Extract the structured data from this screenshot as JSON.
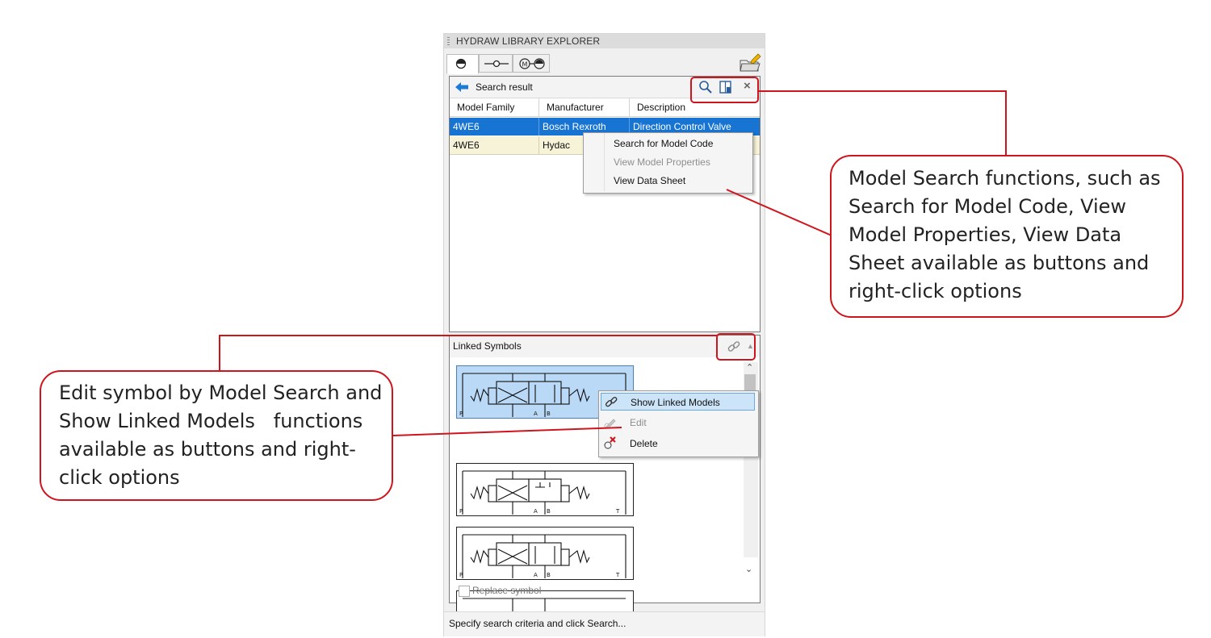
{
  "window": {
    "title": "HYDRAW LIBRARY EXPLORER",
    "tabs": [
      {
        "name": "symbol-tab",
        "icon": "symbol-circle-icon",
        "active": true
      },
      {
        "name": "connection-tab",
        "icon": "line-node-icon",
        "active": false
      },
      {
        "name": "motor-pump-tab",
        "icon": "motor-pump-icon",
        "active": false
      }
    ],
    "open_folder_icon": "open-folder-edit-icon"
  },
  "search_result": {
    "title": "Search result",
    "back_icon": "arrow-left-icon",
    "toolbar_icons": [
      "search-icon",
      "data-sheet-icon",
      "close-icon"
    ],
    "columns": [
      "Model Family",
      "Manufacturer",
      "Description"
    ],
    "rows": [
      {
        "model_family": "4WE6",
        "manufacturer": "Bosch Rexroth",
        "description": "Direction Control Valve",
        "selected": true
      },
      {
        "model_family": "4WE6",
        "manufacturer": "Hydac",
        "description": "",
        "selected": false
      }
    ],
    "context_menu": [
      {
        "label": "Search for Model Code",
        "enabled": true
      },
      {
        "label": "View Model Properties",
        "enabled": false
      },
      {
        "label": "View Data Sheet",
        "enabled": true
      }
    ]
  },
  "linked_symbols": {
    "title": "Linked Symbols",
    "link_icon": "link-icon",
    "symbols": [
      {
        "ports_left": "P",
        "ports_mid": [
          "A",
          "B"
        ],
        "ports_right": "",
        "selected": true
      },
      {
        "ports_left": "P",
        "ports_mid": [
          "A",
          "B"
        ],
        "ports_right": "T",
        "selected": false
      },
      {
        "ports_left": "P",
        "ports_mid": [
          "A",
          "B"
        ],
        "ports_right": "T",
        "selected": false
      },
      {
        "ports_left": "",
        "ports_mid": [
          "",
          ""
        ],
        "ports_right": "",
        "selected": false
      }
    ],
    "context_menu": [
      {
        "label": "Show Linked Models",
        "icon": "link-icon",
        "enabled": true,
        "highlighted": true
      },
      {
        "label": "Edit",
        "icon": "edit-pencil-icon",
        "enabled": false,
        "highlighted": false
      },
      {
        "label": "Delete",
        "icon": "delete-x-icon",
        "enabled": true,
        "highlighted": false
      }
    ],
    "replace_symbol_label": "Replace symbol"
  },
  "status_bar": {
    "text": "Specify search criteria and click Search..."
  },
  "callouts": {
    "right": [
      "Model Search functions, such as",
      "Search for Model Code, View",
      "Model Properties, View Data",
      "Sheet available as buttons and",
      "right-click options"
    ],
    "left": [
      "Edit symbol by Model Search and",
      "Show Linked Models   functions",
      "available as buttons and right-",
      "click options"
    ]
  },
  "colors": {
    "accent": "#d0141c",
    "selection": "#1874d2",
    "highlight_row": "#f7f3d9",
    "symbol_selected": "#b9d9f7"
  }
}
